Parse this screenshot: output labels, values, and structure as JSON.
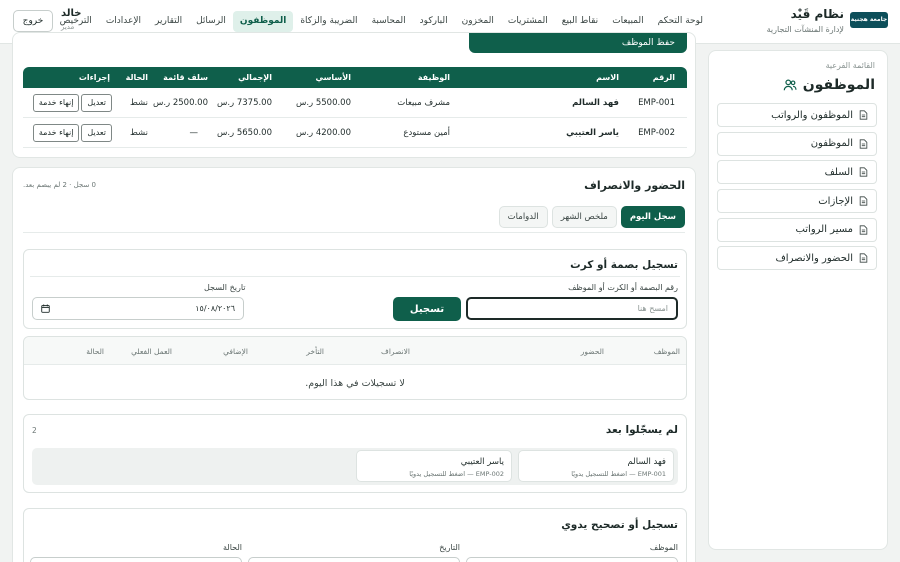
{
  "topbar": {
    "logo_text": "جامعة هجنية",
    "brand_name": "نظام قَيْد",
    "brand_subtitle": "لإدارة المنشآت التجارية",
    "nav": [
      {
        "label": "لوحة التحكم",
        "name": "nav-dashboard"
      },
      {
        "label": "المبيعات",
        "name": "nav-sales"
      },
      {
        "label": "نقاط البيع",
        "name": "nav-pos"
      },
      {
        "label": "المشتريات",
        "name": "nav-purchases"
      },
      {
        "label": "المخزون",
        "name": "nav-inventory"
      },
      {
        "label": "الباركود",
        "name": "nav-barcode"
      },
      {
        "label": "المحاسبة",
        "name": "nav-accounting"
      },
      {
        "label": "الضريبة والزكاة",
        "name": "nav-tax-zakat"
      },
      {
        "label": "الموظفون",
        "name": "nav-employees",
        "active": true
      },
      {
        "label": "الرسائل",
        "name": "nav-messages"
      },
      {
        "label": "التقارير",
        "name": "nav-reports"
      },
      {
        "label": "الإعدادات",
        "name": "nav-settings"
      },
      {
        "label": "الترخيص",
        "name": "nav-license"
      }
    ],
    "user_name": "خالد",
    "user_role": "مدير",
    "logout_label": "خروج"
  },
  "sidebar": {
    "subtitle": "القائمة الفرعية",
    "title": "الموظفون",
    "items": [
      {
        "label": "الموظفون والرواتب"
      },
      {
        "label": "الموظفون"
      },
      {
        "label": "السلف"
      },
      {
        "label": "الإجازات"
      },
      {
        "label": "مسير الرواتب"
      },
      {
        "label": "الحضور والانصراف"
      }
    ]
  },
  "employees": {
    "add_button_label": "حفظ الموظف",
    "columns": [
      "الرقم",
      "الاسم",
      "الوظيفة",
      "الأساسي",
      "الإجمالي",
      "سلف قائمة",
      "الحالة",
      "إجراءات"
    ],
    "rows": [
      {
        "id": "EMP-001",
        "name": "فهد السالم",
        "job": "مشرف مبيعات",
        "basic": "5500.00 ر.س",
        "total": "7375.00 ر.س",
        "advance": "2500.00 ر.س",
        "status": "نشط",
        "edit": "تعديل",
        "terminate": "إنهاء خدمة"
      },
      {
        "id": "EMP-002",
        "name": "ياسر العتيبي",
        "job": "أمين مستودع",
        "basic": "4200.00 ر.س",
        "total": "5650.00 ر.س",
        "advance": "—",
        "status": "نشط",
        "edit": "تعديل",
        "terminate": "إنهاء خدمة"
      }
    ]
  },
  "attendance": {
    "title": "الحضور والانصراف",
    "meta": "0 سجل · 2 لم يبصم بعد.",
    "tabs": [
      {
        "label": "سجل اليوم",
        "active": true
      },
      {
        "label": "ملخص الشهر"
      },
      {
        "label": "الدوامات"
      }
    ],
    "punch": {
      "title": "تسجيل بصمة أو كرت",
      "input_label": "رقم البصمة أو الكرت أو الموظف",
      "input_placeholder": "امسح هنا",
      "button_label": "تسجيل",
      "date_label": "تاريخ السجل",
      "date_value": "١٥/٠٨/٢٠٢٦"
    },
    "log": {
      "columns": [
        "الموظف",
        "الحضور",
        "الانصراف",
        "التأخر",
        "الإضافي",
        "العمل الفعلي",
        "الحالة"
      ],
      "empty_text": "لا تسجيلات في هذا اليوم."
    },
    "absent": {
      "title": "لم يسجّلوا بعد",
      "count": "2",
      "people": [
        {
          "name": "فهد السالم",
          "note": "EMP-001 — اضغط للتسجيل يدويًا"
        },
        {
          "name": "ياسر العتيبي",
          "note": "EMP-002 — اضغط للتسجيل يدويًا"
        }
      ]
    },
    "manual": {
      "title": "تسجيل أو تصحيح يدوي",
      "employee_label": "الموظف",
      "date_label": "التاريخ",
      "status_label": "الحالة"
    }
  },
  "colors": {
    "primary": "#0f5f4b",
    "active_nav_bg": "#dff0ea",
    "page_bg": "#f1f3f2"
  }
}
